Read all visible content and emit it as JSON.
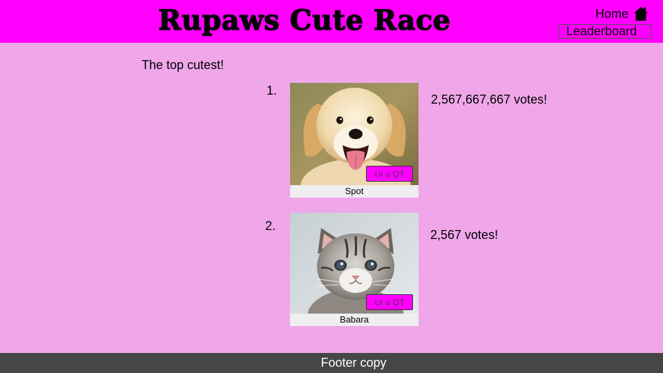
{
  "header": {
    "title": "Rupaws Cute Race",
    "home_label": "Home",
    "home_icon": "house-icon",
    "leaderboard_label": "Leaderboard",
    "background": "#ff00ff"
  },
  "intro": "The top cutest!",
  "entries": [
    {
      "rank": "1.",
      "name": "Spot",
      "votes": "2,567,667,667 votes!",
      "button_label": "Ur a QT",
      "photo": "puppy-photo"
    },
    {
      "rank": "2.",
      "name": "Babara",
      "votes": "2,567 votes!",
      "button_label": "Ur a QT",
      "photo": "kitten-photo"
    }
  ],
  "footer": {
    "text": "Footer copy",
    "background": "#464646"
  },
  "colors": {
    "page_background": "#efa7ea",
    "accent": "#ff00ff"
  }
}
